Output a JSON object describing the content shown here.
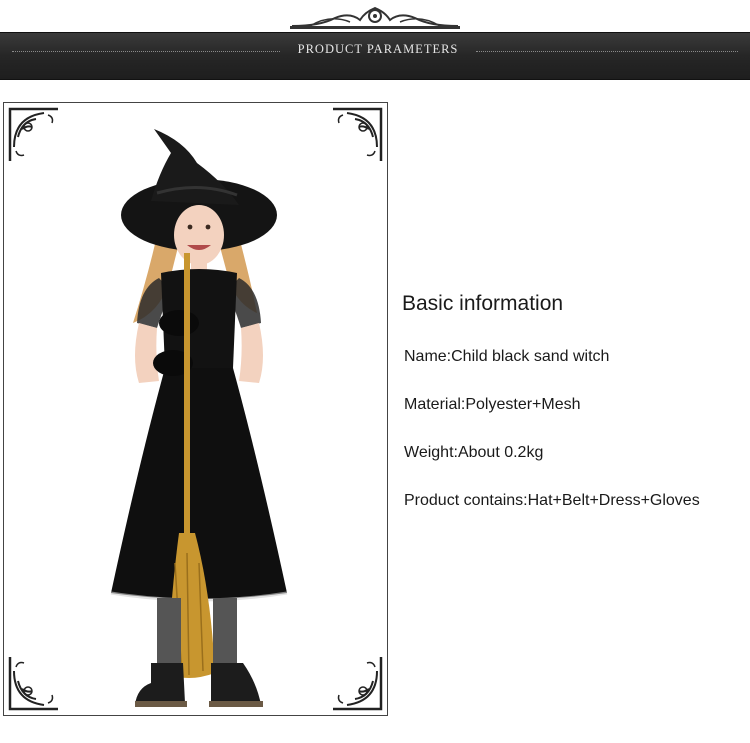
{
  "header": {
    "title": "PRODUCT PARAMETERS"
  },
  "product_image": {
    "subject": "Child black witch costume with hat and broom",
    "colors": {
      "dress": "#111111",
      "broom": "#c8962f",
      "hair": "#d9a86a"
    }
  },
  "basic_info": {
    "heading": "Basic information",
    "rows": [
      "Name:Child black sand witch",
      "Material:Polyester+Mesh",
      "Weight:About 0.2kg",
      "Product contains:Hat+Belt+Dress+Gloves"
    ]
  }
}
